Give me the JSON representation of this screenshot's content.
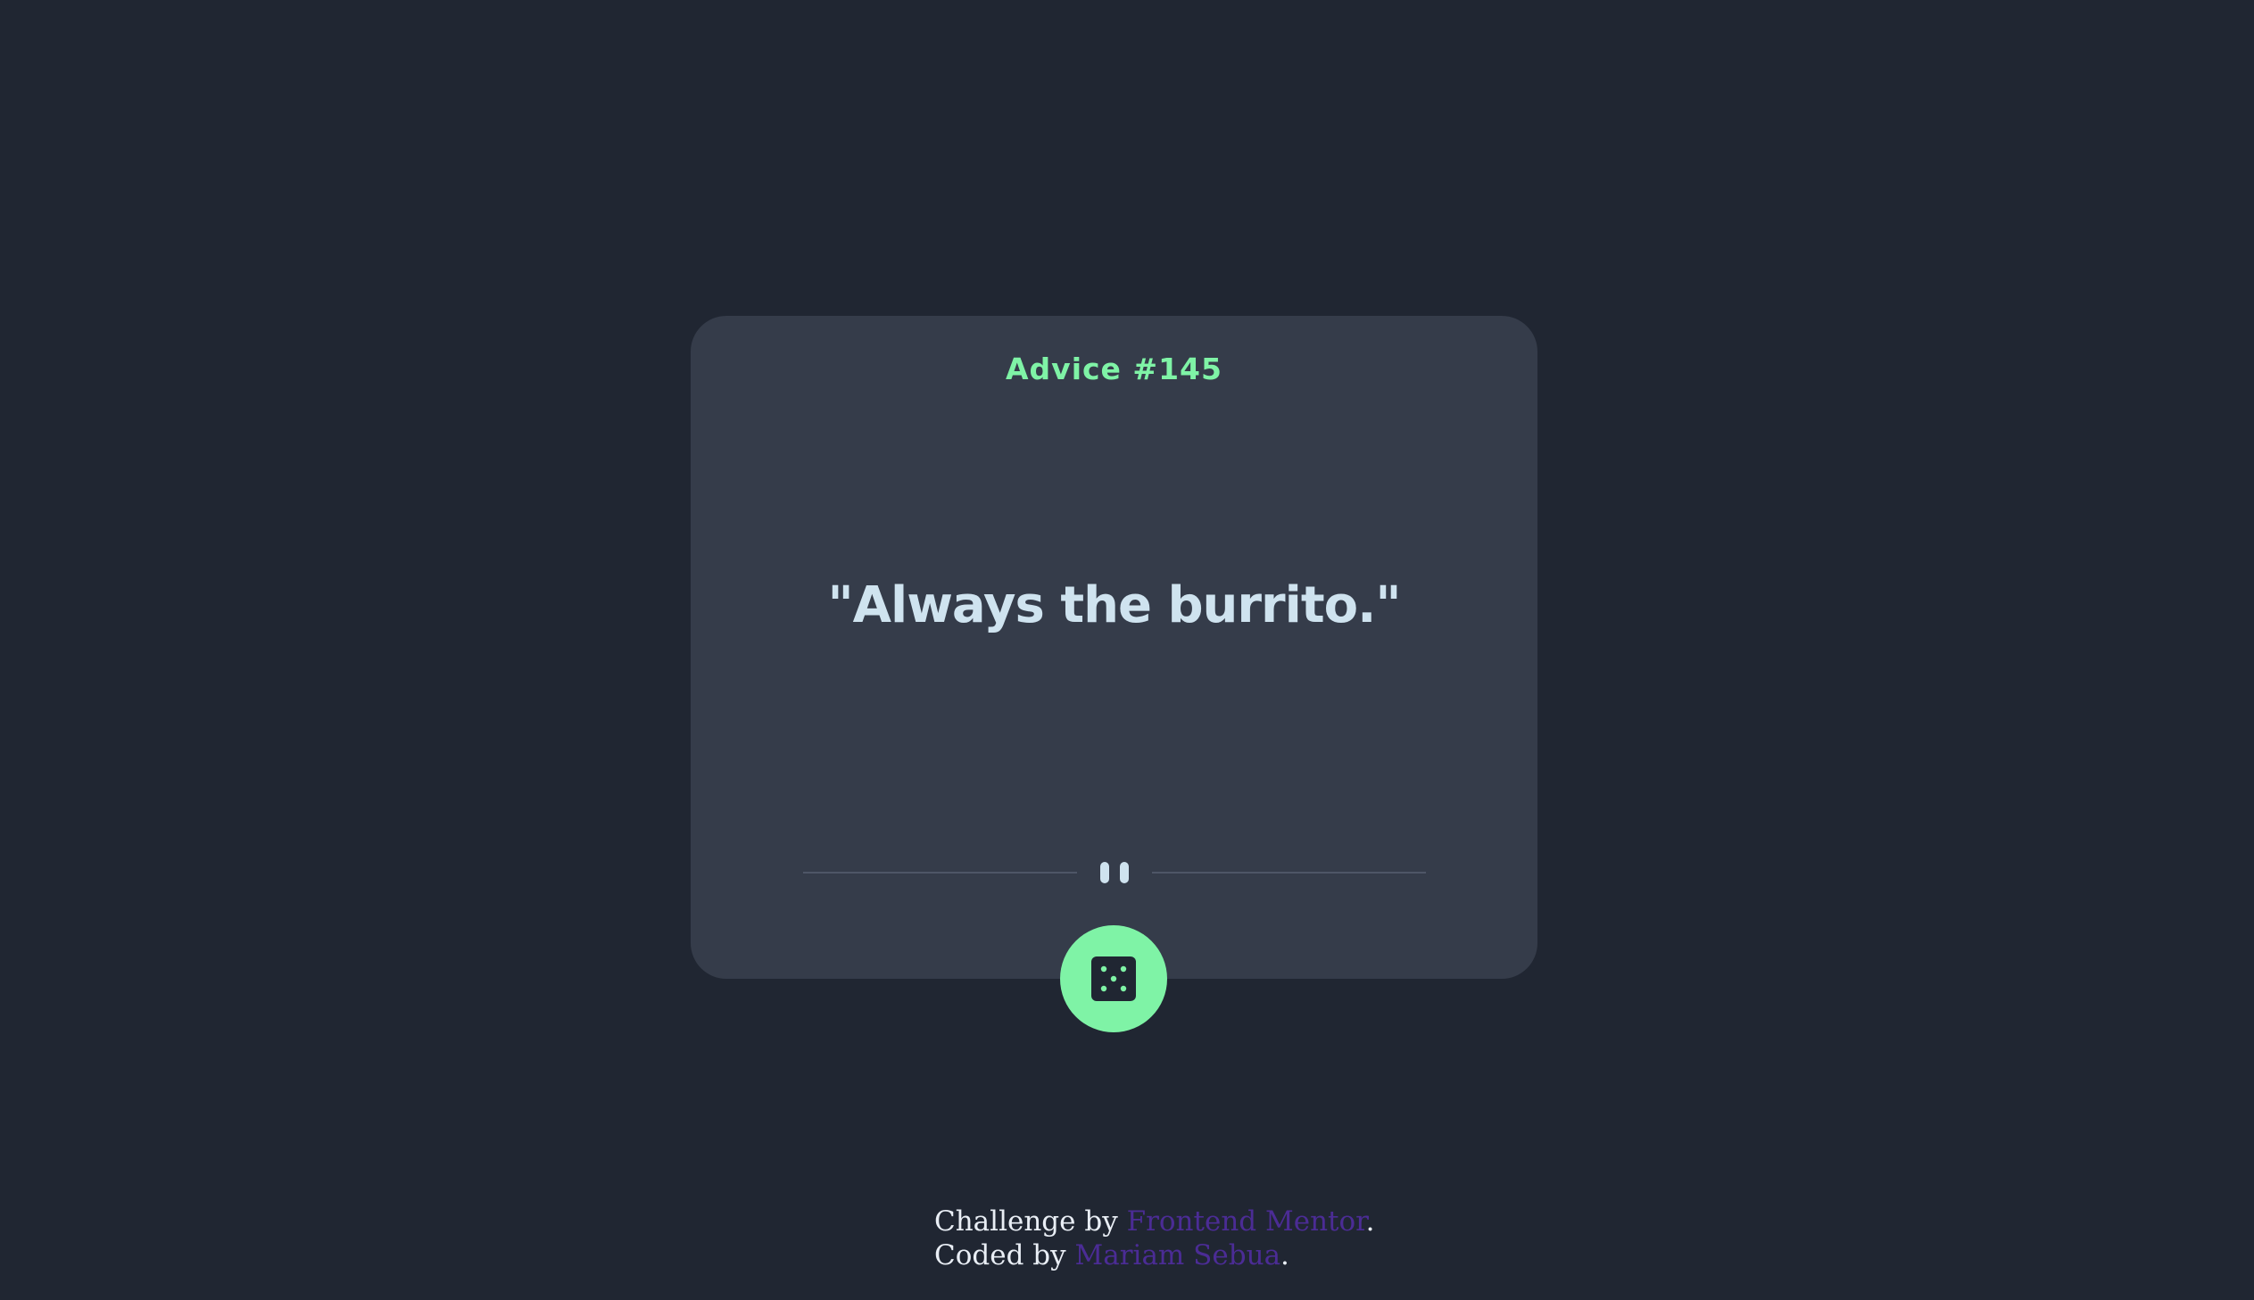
{
  "card": {
    "advice_label": "Advice #145",
    "advice_text": "\"Always the burrito.\""
  },
  "dice_button": {
    "icon": "dice-icon",
    "color": "#7ff3a6"
  },
  "attribution": {
    "challenge_prefix": "Challenge by ",
    "challenge_link": "Frontend Mentor",
    "challenge_suffix": ".",
    "coded_prefix": "Coded by ",
    "coded_link": "Mariam Sebua",
    "coded_suffix": "."
  },
  "colors": {
    "background": "#202632",
    "card": "#353c4a",
    "accent": "#7ff3a6",
    "text": "#cfe3ef",
    "link": "#4b2c95"
  }
}
